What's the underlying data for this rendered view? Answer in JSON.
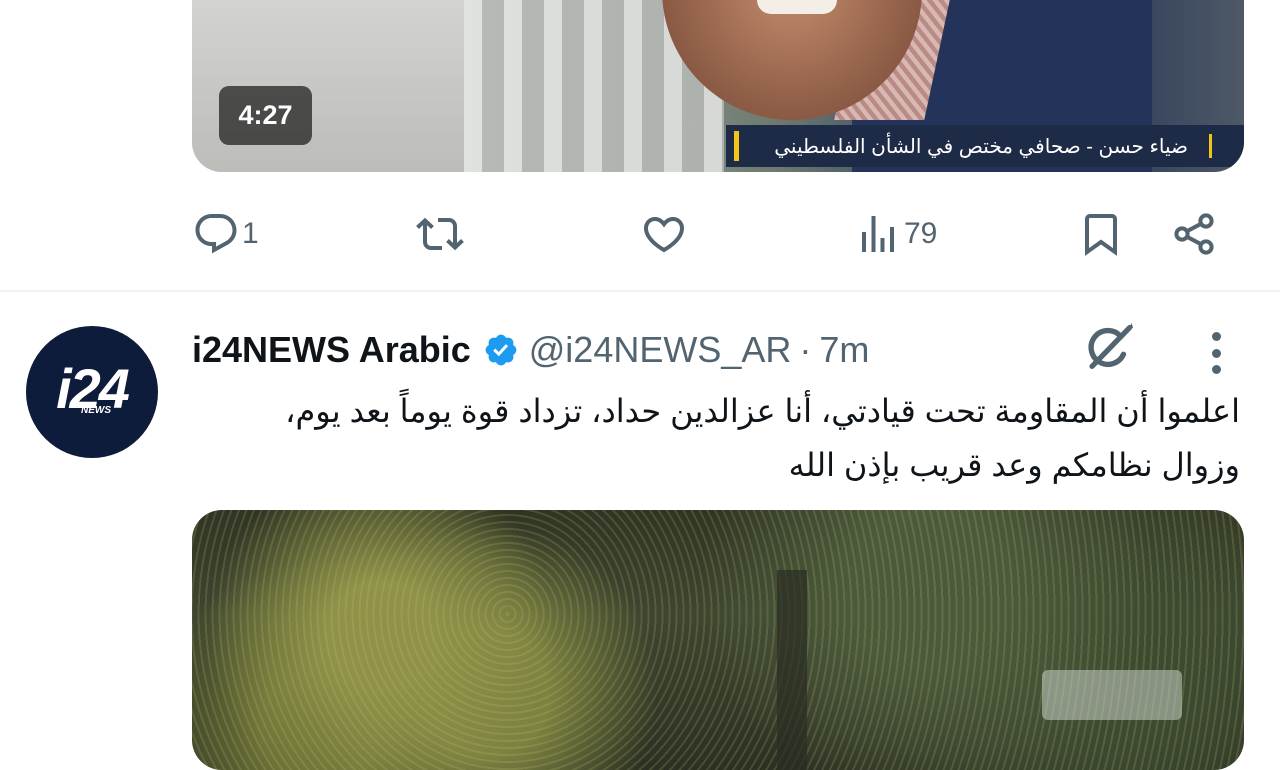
{
  "previous_tweet": {
    "video": {
      "duration": "4:27",
      "caption": "ضياء حسن - صحافي مختص في الشأن الفلسطيني"
    },
    "actions": {
      "replies": "1",
      "reposts": "",
      "likes": "",
      "views": "79"
    }
  },
  "tweet": {
    "avatar_logo": "i24",
    "avatar_logo_sub": "NEWS",
    "display_name": "i24NEWS Arabic",
    "verified": true,
    "handle": "@i24NEWS_AR",
    "separator": "·",
    "time": "7m",
    "text_lines": [
      "اعلموا أن المقاومة تحت قيادتي، أنا عزالدين حداد، تزداد قوة يوماً بعد يوم،",
      "وزوال نظامكم وعد قريب بإذن الله"
    ]
  },
  "icons": {
    "reply": "reply-icon",
    "repost": "repost-icon",
    "like": "like-icon",
    "views": "views-icon",
    "bookmark": "bookmark-icon",
    "share": "share-icon",
    "grok": "grok-icon",
    "more": "more-icon",
    "verified": "verified-badge-icon"
  },
  "colors": {
    "text_primary": "#0f1419",
    "text_secondary": "#536471",
    "verified_blue": "#1d9bf0",
    "divider": "#eff3f4"
  }
}
